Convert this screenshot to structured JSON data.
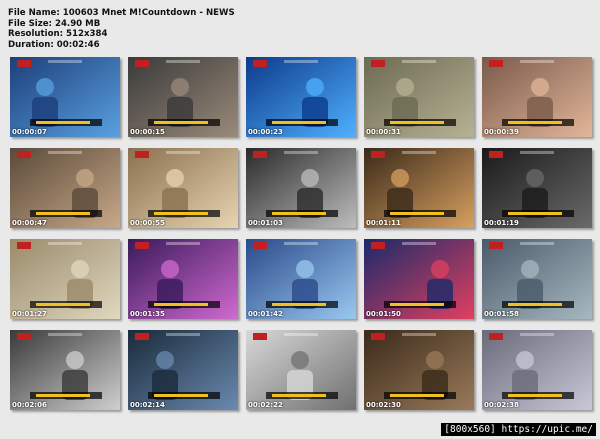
{
  "info": {
    "file_name": "File Name: 100603 Mnet M!Countdown - NEWS",
    "file_size": "File Size: 24.90 MB",
    "resolution": "Resolution: 512x384",
    "duration": "Duration: 00:02:46"
  },
  "thumbnails": [
    {
      "time": "00:00:07",
      "bg": "#1c3f7a",
      "accent": "#5aa0e0"
    },
    {
      "time": "00:00:15",
      "bg": "#3a3a3a",
      "accent": "#9a8a7a"
    },
    {
      "time": "00:00:23",
      "bg": "#0d3a8a",
      "accent": "#4fb0ff"
    },
    {
      "time": "00:00:31",
      "bg": "#6b6a52",
      "accent": "#b8b294"
    },
    {
      "time": "00:00:39",
      "bg": "#7a5a4a",
      "accent": "#e2b69a"
    },
    {
      "time": "00:00:47",
      "bg": "#5a4a3a",
      "accent": "#c8a888"
    },
    {
      "time": "00:00:55",
      "bg": "#8a7050",
      "accent": "#e8d4b0"
    },
    {
      "time": "00:01:03",
      "bg": "#2a2a2a",
      "accent": "#bdbdbd"
    },
    {
      "time": "00:01:11",
      "bg": "#3a2a1a",
      "accent": "#d8a060"
    },
    {
      "time": "00:01:19",
      "bg": "#1a1a1a",
      "accent": "#6a6a6a"
    },
    {
      "time": "00:01:27",
      "bg": "#9a8a6a",
      "accent": "#e0d8c0"
    },
    {
      "time": "00:01:35",
      "bg": "#3a1a5a",
      "accent": "#d06ad0"
    },
    {
      "time": "00:01:42",
      "bg": "#2a4a8a",
      "accent": "#9ac8f0"
    },
    {
      "time": "00:01:50",
      "bg": "#1a2a6a",
      "accent": "#e04060"
    },
    {
      "time": "00:01:58",
      "bg": "#4a5a6a",
      "accent": "#a8b8c0"
    },
    {
      "time": "00:02:06",
      "bg": "#3a3a3a",
      "accent": "#cfcfcf"
    },
    {
      "time": "00:02:14",
      "bg": "#1a2a3a",
      "accent": "#6a8ab0"
    },
    {
      "time": "00:02:22",
      "bg": "#d8d8d8",
      "accent": "#707070"
    },
    {
      "time": "00:02:30",
      "bg": "#3a2a1a",
      "accent": "#9a7a5a"
    },
    {
      "time": "00:02:38",
      "bg": "#6a6a7a",
      "accent": "#c8c8d8"
    }
  ],
  "footer": {
    "label": "[800x560] https://upic.me/"
  }
}
